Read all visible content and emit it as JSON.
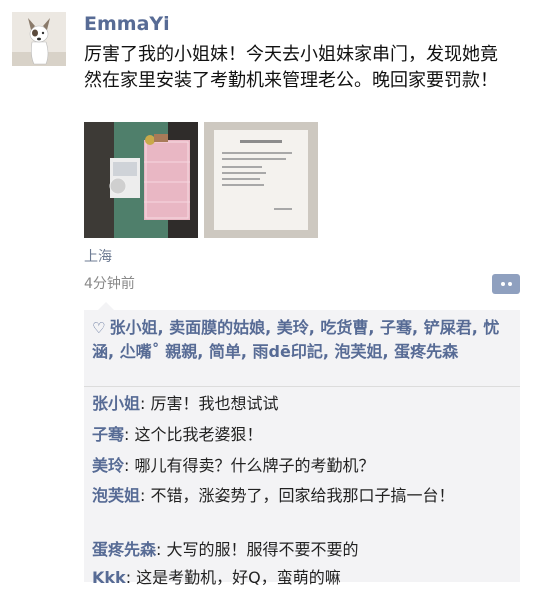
{
  "post": {
    "author": "EmmaYi",
    "text": "厉害了我的小姐妹！今天去小姐妹家串门，发现她竟然在家里安装了考勤机来管理老公。晚回家要罚款！",
    "location": "上海",
    "time": "4分钟前"
  },
  "likes": {
    "names": "张小姐, 卖面膜的姑娘, 美玲, 吃货曹, 子骞, 铲屎君, 忧涵, 尐嘴˚ 親親, 简单, 雨dē印記, 泡芙姐, 蛋疼先森"
  },
  "comments": [
    {
      "name": "张小姐",
      "text": ": 厉害！我也想试试"
    },
    {
      "name": "子骞",
      "text": ": 这个比我老婆狠！"
    },
    {
      "name": "美玲",
      "text": ": 哪儿有得卖？什么牌子的考勤机？"
    },
    {
      "name": "泡芙姐",
      "text": ": 不错，涨姿势了，回家给我那口子搞一台！"
    },
    {
      "name": "蛋疼先森",
      "text": ": 大写的服！服得不要不要的"
    },
    {
      "name": "Kkk",
      "text": ": 这是考勤机，好Q，蛮萌的嘛"
    }
  ]
}
